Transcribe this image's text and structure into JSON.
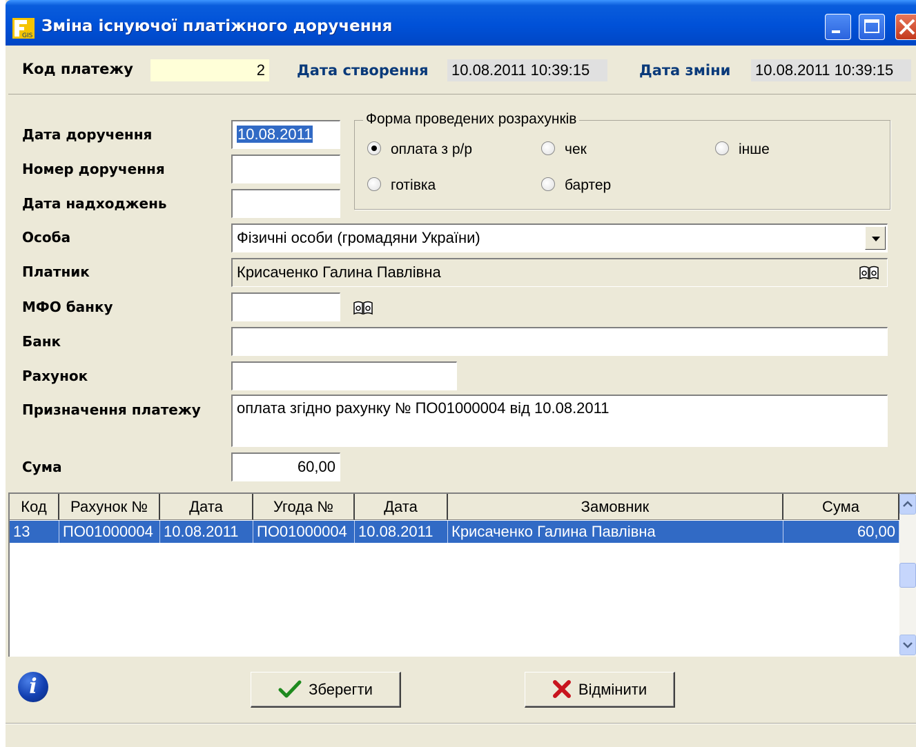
{
  "window": {
    "title": "Зміна існуючої платіжного доручення"
  },
  "header": {
    "payment_code_label": "Код платежу",
    "payment_code_value": "2",
    "created_label": "Дата створення",
    "created_value": "10.08.2011 10:39:15",
    "modified_label": "Дата зміни",
    "modified_value": "10.08.2011 10:39:15"
  },
  "form": {
    "order_date_label": "Дата доручення",
    "order_date_value": "10.08.2011",
    "order_number_label": "Номер доручення",
    "order_number_value": "",
    "receipt_date_label": "Дата надходжень",
    "receipt_date_value": "",
    "person_label": "Особа",
    "person_value": "Фізичні особи (громадяни України)",
    "payer_label": "Платник",
    "payer_value": "Крисаченко Галина Павлівна",
    "mfo_label": "МФО банку",
    "mfo_value": "",
    "bank_label": "Банк",
    "bank_value": "",
    "account_label": "Рахунок",
    "account_value": "",
    "purpose_label": "Призначення платежу",
    "purpose_value": "оплата згідно рахунку № ПО01000004 від 10.08.2011",
    "sum_label": "Сума",
    "sum_value": "60,00"
  },
  "payment_form": {
    "title": "Форма проведених розрахунків",
    "options": [
      {
        "label": "оплата з р/р",
        "checked": true
      },
      {
        "label": "чек",
        "checked": false
      },
      {
        "label": "інше",
        "checked": false
      },
      {
        "label": "готівка",
        "checked": false
      },
      {
        "label": "бартер",
        "checked": false
      }
    ]
  },
  "table": {
    "columns": [
      "Код",
      "Рахунок №",
      "Дата",
      "Угода №",
      "Дата",
      "Замовник",
      "Сума"
    ],
    "rows": [
      [
        "13",
        "ПО01000004",
        "10.08.2011",
        "ПО01000004",
        "10.08.2011",
        "Крисаченко Галина Павлівна",
        "60,00"
      ]
    ]
  },
  "buttons": {
    "save_label": "Зберегти",
    "cancel_label": "Відмінити"
  },
  "colors": {
    "titlebar": "#0a5ddc",
    "window_bg": "#ece9d8",
    "selection": "#316ac5",
    "header_label": "#0a3a7a",
    "code_field": "#ffffd8"
  },
  "icons": {
    "app": "app-icon",
    "info": "info-icon",
    "book": "book-icon",
    "save": "checkmark-icon",
    "cancel": "x-icon"
  }
}
